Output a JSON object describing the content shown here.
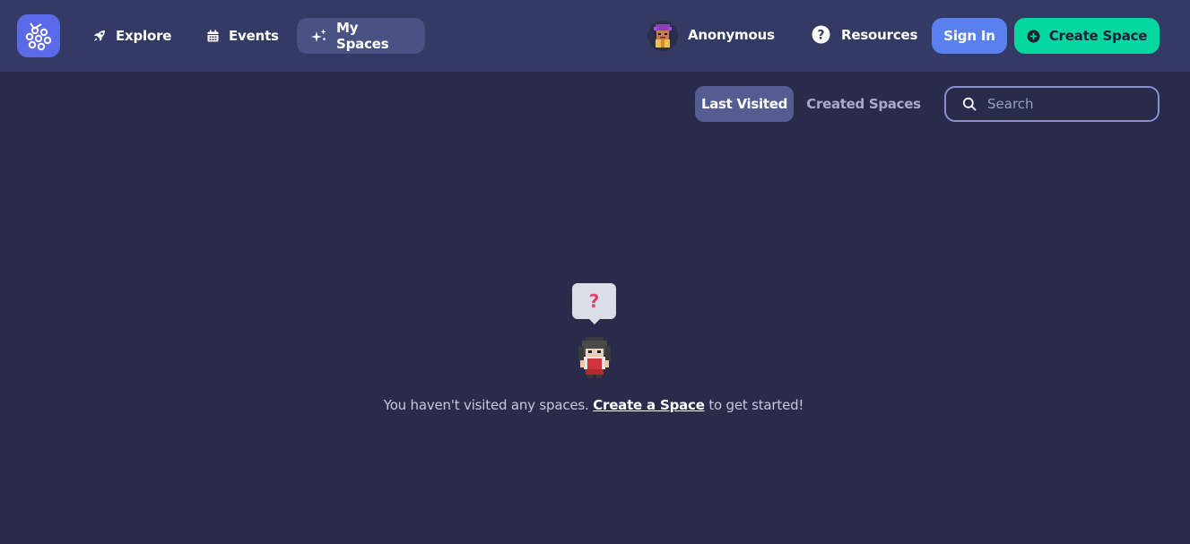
{
  "nav": {
    "explore": "Explore",
    "events": "Events",
    "my_spaces": "My Spaces"
  },
  "user": {
    "name": "Anonymous"
  },
  "header": {
    "resources": "Resources",
    "sign_in": "Sign In",
    "create_space": "Create Space"
  },
  "tabs": {
    "last_visited": "Last Visited",
    "created_spaces": "Created Spaces"
  },
  "search": {
    "placeholder": "Search",
    "value": ""
  },
  "empty_state": {
    "bubble_glyph": "?",
    "message_before": "You haven't visited any spaces.",
    "link": "Create a Space",
    "message_after": "to get started!"
  },
  "colors": {
    "background": "#282b4a",
    "topbar": "#333a64",
    "brand": "#5a6ae8",
    "sign_in": "#5a80f0",
    "create_space": "#06d6a0",
    "active_tab": "#545c92"
  },
  "icons": {
    "logo": "gather-logo-icon",
    "explore": "rocket-icon",
    "events": "calendar-icon",
    "my_spaces": "sparkles-icon",
    "resources": "question-circle-icon",
    "create": "plus-circle-icon",
    "search": "search-icon"
  }
}
